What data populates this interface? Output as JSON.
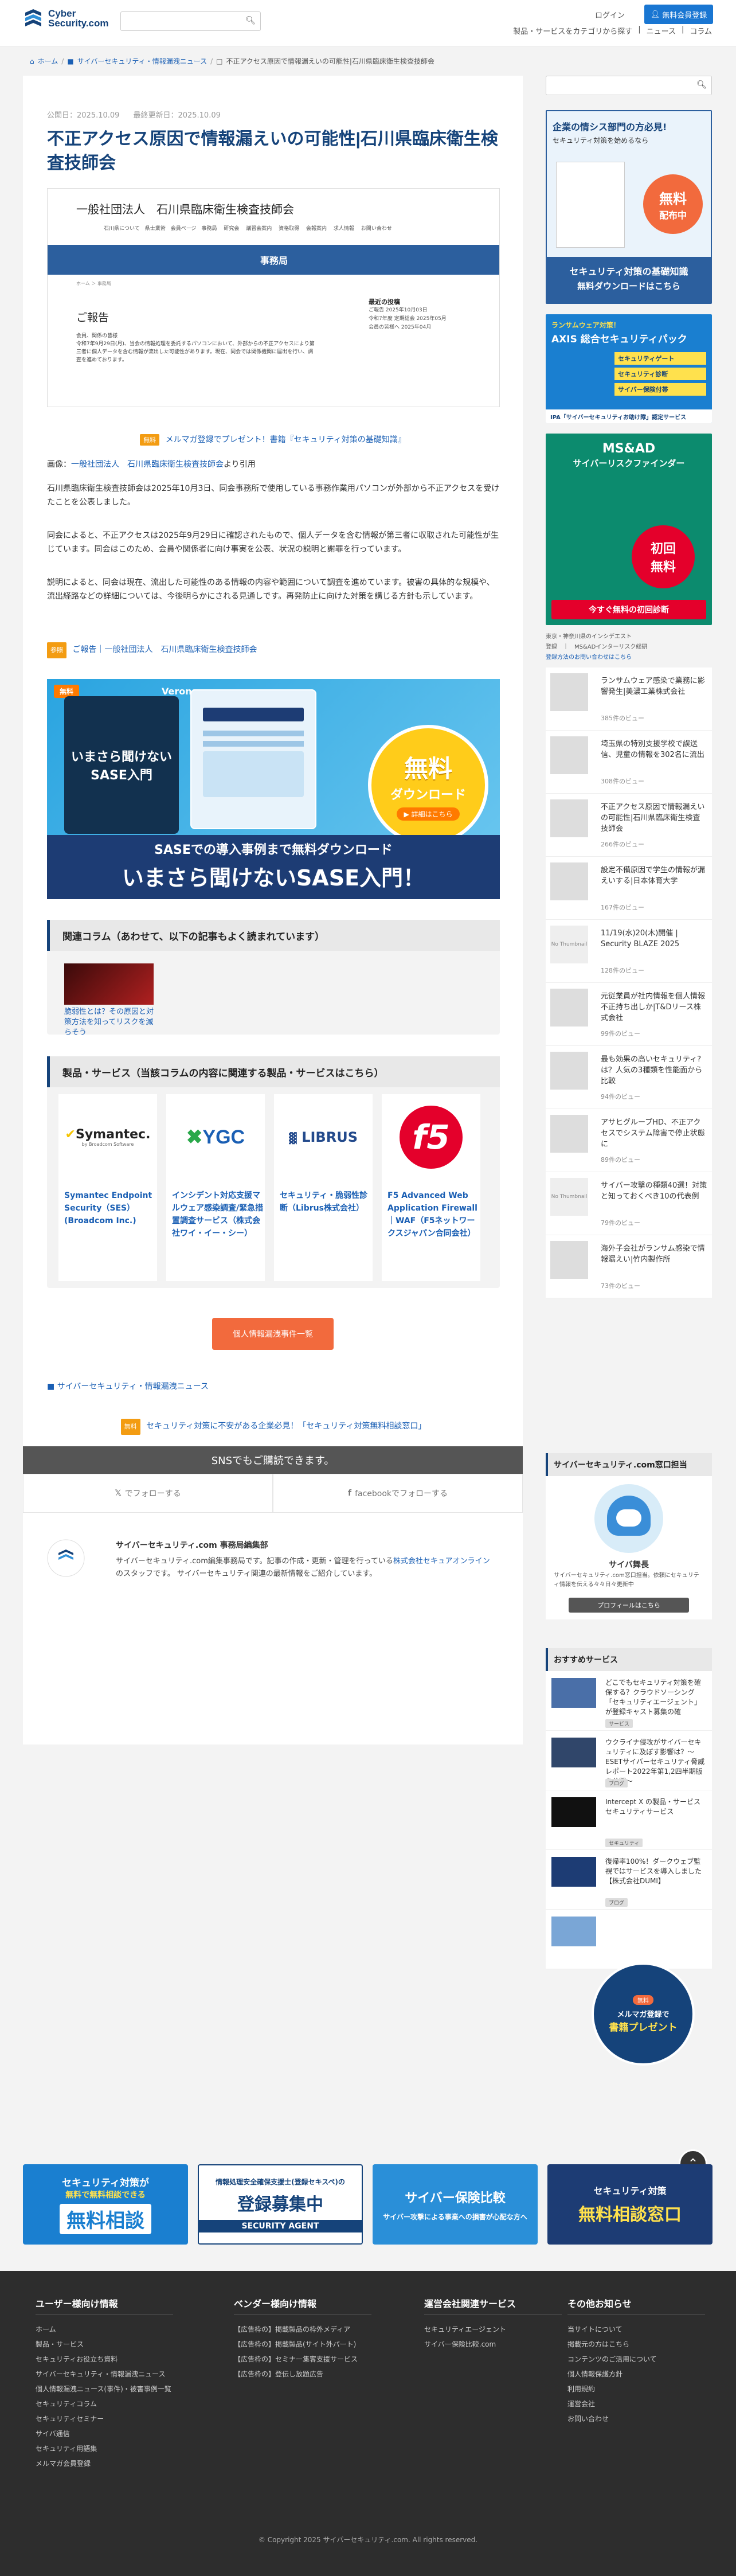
{
  "header": {
    "logo_line1": "Cyber",
    "logo_line2": "Security.com",
    "login": "ログイン",
    "member_button": "無料会員登録",
    "nav": [
      "製品・サービスをカテゴリから探す",
      "ニュース",
      "コラム"
    ],
    "nav_sep": "|"
  },
  "breadcrumb": [
    "ホーム",
    "サイバーセキュリティ・情報漏洩ニュース",
    "不正アクセス原因で情報漏えいの可能性|石川県臨床衛生検査技師会"
  ],
  "article": {
    "published": "公開日：2025.10.09",
    "updated": "最終更新日：2025.10.09",
    "title": "不正アクセス原因で情報漏えいの可能性|石川県臨床衛生検査技師会",
    "hero": {
      "org": "一般社団法人　石川県臨床衛生検査技師会",
      "nav": "石川県について　県士業術　会員ページ　事務局　 研究会　 講習会案内　 資格取得　 会報案内　 求人情報　 お問い合わせ",
      "band": "事務局",
      "bc": "ホーム ＞ 事務局",
      "report": "ご報告",
      "para": "会員、関係の皆様\n令和7年9月29日(月)、当会の情報処理を委託するパソコンにおいて、外部からの不正アクセスにより第三者に個人データを含む情報が流出した可能性があります。現在、同会では関係機関に届出を行い、調査を進めております。",
      "right_title": "最近の投稿",
      "right_items": [
        "ご報告 2025年10月03日",
        "令和7年度 定期総会 2025年05月",
        "会員の皆様へ 2025年04月"
      ]
    },
    "promo_tag": "無料",
    "promo_text": "メルマガ登録でプレゼント！書籍『セキュリティ対策の基礎知識』",
    "image_source_label": "画像：",
    "image_source_link": "一般社団法人　石川県臨床衛生検査技師会",
    "image_source_suffix": "より引用",
    "p1": "石川県臨床衛生検査技師会は2025年10月3日、同会事務所で使用している事務作業用パソコンが外部から不正アクセスを受けたことを公表しました。",
    "p2": "同会によると、不正アクセスは2025年9月29日に確認されたもので、個人データを含む情報が第三者に収取された可能性が生じています。同会はこのため、会員や関係者に向け事実を公表、状況の説明と謝罪を行っています。",
    "p3": "説明によると、同会は現在、流出した可能性のある情報の内容や範囲について調査を進めています。被害の具体的な規模や、流出経路などの詳細については、今後明らかにされる見通しです。再発防止に向けた対策を講じる方針も示しています。",
    "ref_tag": "参照",
    "ref_text": "ご報告｜一般社団法人　石川県臨床衛生検査技師会",
    "sase_badge": "無料",
    "sase_book_title": "いまさら聞けない\nSASE入門",
    "sase_circle_top": "無料",
    "sase_circle_mid": "ダウンロード",
    "sase_circle_bot": "▶ 詳細はこちら",
    "sase_sub": "SASEでの導入事例まで無料ダウンロード",
    "sase_main": "いまさら聞けないSASE入門！",
    "sase_verona": "Verona"
  },
  "related": {
    "heading": "関連コラム（あわせて、以下の記事もよく読まれています）",
    "items": [
      {
        "title": "脆弱性とは？その原因と対策方法を知ってリスクを減らそう"
      }
    ]
  },
  "products": {
    "heading": "製品・サービス（当該コラムの内容に関連する製品・サービスはこちら）",
    "items": [
      {
        "logo": "Symantec.",
        "logo_sub": "by Broadcom Software",
        "name": "Symantec Endpoint Security（SES）(Broadcom Inc.)"
      },
      {
        "logo": "YGC",
        "name": "インシデント対応支援マルウェア感染調査/緊急措置調査サービス（株式会社ワイ・イー・シー）"
      },
      {
        "logo": "LIBRUS",
        "name": "セキュリティ・脆弱性診断（Librus株式会社）"
      },
      {
        "logo": "f5",
        "name": "F5 Advanced Web Application Firewall｜WAF（F5ネットワークスジャパン合同会社）"
      }
    ],
    "more_button": "個人情報漏洩事件一覧"
  },
  "category_link": "サイバーセキュリティ・情報漏洩ニュース",
  "consult_tag": "無料",
  "consult_text": "セキュリティ対策に不安がある企業必見！「セキュリティ対策無料相談窓口」",
  "sns": {
    "heading": "SNSでもご購読できます。",
    "x": "でフォローする",
    "facebook": "facebookでフォローする"
  },
  "editor": {
    "name": "サイバーセキュリティ.com 事務局編集部",
    "desc_pre": "サイバーセキュリティ.com編集事務局です。記事の作成・更新・管理を行っている",
    "desc_link": "株式会社セキュアオンライン",
    "desc_post": "のスタッフです。 サイバーセキュリティ関連の最新情報をご紹介しています。"
  },
  "sidebar": {
    "ad1": {
      "line1": "企業の情シス部門の方必見!",
      "line2": "セキュリティ対策を始めるなら",
      "free": "無料",
      "dist": "配布中",
      "bottom1": "セキュリティ対策の基礎知識",
      "bottom2": "無料ダウンロードはこちら"
    },
    "ad2": {
      "line1": "ランサムウェア対策！",
      "line2": "AXIS 総合セキュリティパック",
      "pills": [
        "セキュリティゲート",
        "セキュリティ診断",
        "サイバー保険付帯"
      ],
      "foot": "IPA「サイバーセキュリティお助け隊」認定サービス"
    },
    "ad3": {
      "line1": "MS&AD",
      "line2": "サイバーリスクファインダー",
      "line3": "今すぐ無料の初回診断",
      "free": "初回",
      "free2": "無料"
    },
    "tags_line1": "東京・神奈川県のインシデエスト",
    "tags_line2": "登録　｜　MS&ADインターリスク総研",
    "tags_link": "登録方法のお問い合わせはこちら",
    "ranking": [
      {
        "title": "ランサムウェア感染で業務に影響発生|美濃工業株式会社",
        "views": "385件のビュー"
      },
      {
        "title": "埼玉県の特別支援学校で誤送信、児童の情報を302名に流出",
        "views": "308件のビュー"
      },
      {
        "title": "不正アクセス原因で情報漏えいの可能性|石川県臨床衛生検査技師会",
        "views": "266件のビュー"
      },
      {
        "title": "設定不備原因で学生の情報が漏えいする|日本体育大学",
        "views": "167件のビュー"
      },
      {
        "title": "11/19(水)20(木)開催 | Security BLAZE 2025",
        "views": "128件のビュー"
      },
      {
        "title": "元従業員が社内情報を個人情報不正持ち出しか|T&Dリース株式会社",
        "views": "99件のビュー"
      },
      {
        "title": "最も効果の高いセキュリティ?は？人気の3種類を性能面から比較",
        "views": "94件のビュー"
      },
      {
        "title": "アサヒグループHD、不正アクセスでシステム障害で停止状態に",
        "views": "89件のビュー"
      },
      {
        "title": "サイバー攻撃の種類40選！対策と知っておくべき10の代表例",
        "views": "79件のビュー"
      },
      {
        "title": "海外子会社がランサム感染で情報漏えい|竹内製作所",
        "views": "73件のビュー"
      }
    ],
    "no_thumb": "No Thumbnail",
    "editor_box": {
      "heading": "サイバーセキュリティ.com窓口担当",
      "name": "サイバ舞長",
      "desc": "サイバーセキュリティ.com窓口担当。依頼にセキュリティ情報を伝える々々日々更新中",
      "button": "プロフィールはこちら"
    },
    "services_heading": "おすすめサービス",
    "services": [
      {
        "title": "どこでもセキュリティ対策を確保する？クラウドソーシング「セキュリティエージェント」が登録キャスト募集の確",
        "pill": "サービス"
      },
      {
        "title": "ウクライナ侵攻がサイバーセキュリティに及ぼす影響は？〜ESETサイバーセキュリティ脅威レポート2022年第1,2四半期版を公開〜",
        "pill": "ブログ"
      },
      {
        "title": "Intercept X の製品・サービスセキュリティサービス",
        "pill": "セキュリティ"
      },
      {
        "title": "復帰率100%！ダークウェブ監視ではサービスを導入しました【株式会社DUMI】",
        "pill": "ブログ"
      },
      {
        "title": "",
        "pill": ""
      }
    ],
    "mail_bubble_1": "メルマガ登録で",
    "mail_bubble_2": "書籍プレゼント",
    "mail_badge": "無料"
  },
  "banners": [
    {
      "top": "セキュリティ対策が",
      "mid": "無料で無料相談できる",
      "big": "無料相談"
    },
    {
      "top": "情報処理安全確保支援士(登録セキスペ)の",
      "big": "登録募集中",
      "foot": "SECURITY AGENT"
    },
    {
      "top": "サイバー保険比較",
      "mid": "サイバー攻撃による事業への損害が心配な方へ"
    },
    {
      "top": "セキュリティ対策",
      "big": "無料相談窓口"
    }
  ],
  "footer": {
    "cols": [
      {
        "title": "ユーザー様向け情報",
        "items": [
          "ホーム",
          "製品・サービス",
          "セキュリティお役立ち資料",
          "サイバーセキュリティ・情報漏洩ニュース",
          "個人情報漏洩ニュース(事件)・被害事例一覧",
          "セキュリティコラム",
          "セキュリティセミナー",
          "サイバ通信",
          "セキュリティ用語集",
          "メルマガ会員登録"
        ]
      },
      {
        "title": "ベンダー様向け情報",
        "items": [
          "【広告枠の】掲載製品の枠外メディア",
          "【広告枠の】掲載製品(サイト外パート)",
          "【広告枠の】セミナー集客支援サービス",
          "【広告枠の】登伝し放題広告"
        ]
      },
      {
        "title": "運営会社関連サービス",
        "items": [
          "セキュリティエージェント",
          "サイバー保険比較.com"
        ]
      },
      {
        "title": "その他お知らせ",
        "items": [
          "当サイトについて",
          "掲載元の方はこちら",
          "コンテンツのご活用について",
          "個人情報保護方針",
          "利用規約",
          "運営会社",
          "お問い合わせ"
        ]
      }
    ],
    "copyright": "© Copyright 2025 サイバーセキュリティ.com. All rights reserved."
  }
}
